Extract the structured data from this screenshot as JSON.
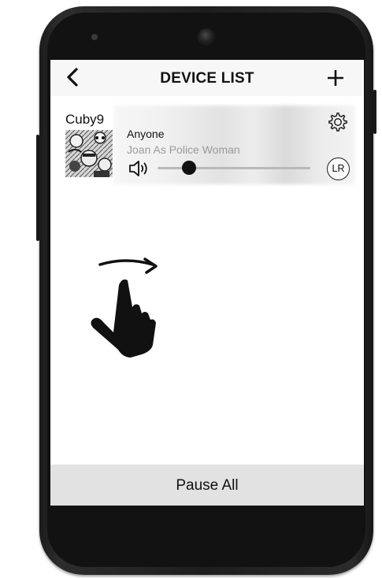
{
  "header": {
    "title": "DEVICE LIST",
    "back_icon": "chevron-left-icon",
    "add_icon": "plus-icon"
  },
  "device": {
    "name": "Cuby9",
    "track_title": "Anyone",
    "track_artist": "Joan As Police Woman",
    "volume_fraction": 0.2,
    "channel_label": "LR",
    "settings_icon": "gear-icon",
    "volume_icon": "speaker-icon"
  },
  "footer": {
    "pause_all_label": "Pause All"
  },
  "gesture": {
    "icon": "swipe-hand-icon"
  },
  "colors": {
    "screen_bg": "#ffffff",
    "topbar_bg": "#f7f7f7",
    "bottombar_bg": "#e2e2e2",
    "artist_text": "#9a9a9a",
    "phone_body": "#1e1e1e"
  }
}
